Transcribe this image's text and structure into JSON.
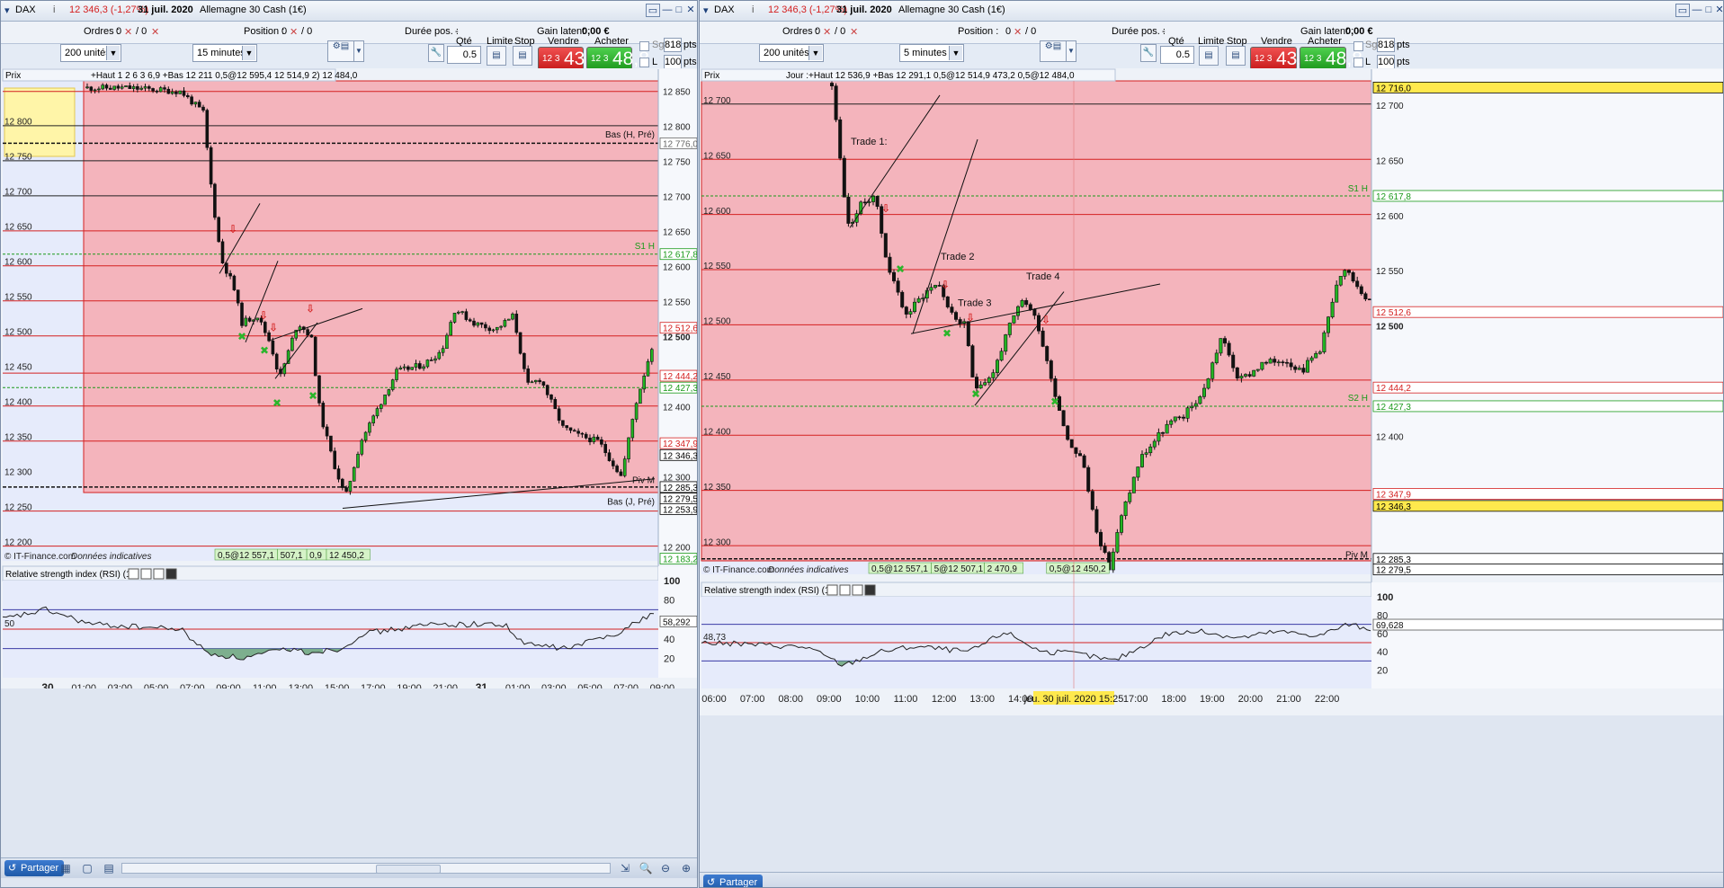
{
  "windows": [
    {
      "id": "w1",
      "title": {
        "symbol": "DAX",
        "quote": "12 346,3 (-1,27%)",
        "date": "31 juil. 2020",
        "instrument": "Allemagne 30 Cash (1€)"
      },
      "info": {
        "orders_label": "Ordres :",
        "orders_value": "0",
        "orders_sep": "/ 0",
        "position_label": "Position :",
        "position_value": "0",
        "position_sep": "/ 0",
        "duration_label": "Durée pos. :",
        "duration_value": "-",
        "gain_label": "Gain latent :",
        "gain_value": "0,00 €"
      },
      "toolbar": {
        "units": "200 unités",
        "interval": "15 minutes",
        "qty_label": "Qté",
        "qty_value": "0.5",
        "limit_label": "Limite",
        "stop_label": "Stop",
        "sell_label": "Vendre",
        "buy_label": "Acheter",
        "sell_small": "12 3",
        "sell_big": "43,8",
        "buy_small": "12 3",
        "buy_big": "48,8",
        "sg_label": "Sg",
        "pts_value_1": "818",
        "pts_label_1": "pts",
        "l_label": "L",
        "pts_value_2": "100",
        "pts_label_2": "pts"
      },
      "chart_header": {
        "label": "Prix",
        "legend": "+Haut 1 2 6 3 6,9 +Bas 12 211 0,5@12 595,4 12 514,9 2) 12 484,0"
      },
      "chart_data": {
        "type": "candlestick",
        "ylim": [
          12180,
          12865
        ],
        "x_ticks": [
          "30",
          "01:00",
          "03:00",
          "05:00",
          "07:00",
          "09:00",
          "11:00",
          "13:00",
          "15:00",
          "17:00",
          "19:00",
          "21:00",
          "31",
          "01:00",
          "03:00",
          "05:00",
          "07:00",
          "09:00"
        ],
        "y_ticks_left": [
          "12 800",
          "12 750",
          "12 700",
          "12 650",
          "12 600",
          "12 550",
          "12 500",
          "12 450",
          "12 400",
          "12 350",
          "12 300",
          "12 250",
          "12 200"
        ],
        "y_ticks_right": [
          "12 850",
          "12 800",
          "12 750",
          "12 700",
          "12 650",
          "12 600",
          "12 550",
          "12 500",
          "12 400",
          "12 300",
          "12 200"
        ],
        "price_tags": [
          {
            "text": "12 776,0",
            "value": 12776,
            "color": "#666666"
          },
          {
            "text": "12 617,8",
            "value": 12617.8,
            "color": "#1a9a1a"
          },
          {
            "text": "12 512,6",
            "value": 12512.6,
            "color": "#d42020"
          },
          {
            "text": "12 444,2",
            "value": 12444.2,
            "color": "#d42020"
          },
          {
            "text": "12 427,3",
            "value": 12427.3,
            "color": "#1a9a1a"
          },
          {
            "text": "12 347,9",
            "value": 12347.9,
            "color": "#d42020"
          },
          {
            "text": "12 346,3",
            "value": 12331,
            "color": "#000000"
          },
          {
            "text": "12 285,3",
            "value": 12285.3,
            "color": "#000000"
          },
          {
            "text": "12 279,5",
            "value": 12269,
            "color": "#000000"
          },
          {
            "text": "12 253,9",
            "value": 12253.9,
            "color": "#000000"
          },
          {
            "text": "12 183,2",
            "value": 12183.2,
            "color": "#1a9a1a"
          }
        ],
        "line_labels": [
          {
            "text": "Bas (H, Pré)",
            "value": 12784
          },
          {
            "text": "S1 H",
            "value": 12625
          },
          {
            "text": "Piv M",
            "value": 12291
          },
          {
            "text": "Bas (J, Pré)",
            "value": 12260
          }
        ],
        "order_labels": [
          "0,5@12 557,1",
          "507,1",
          "0,9",
          "12 450,2"
        ],
        "copyright": "© IT-Finance.com",
        "disclaimer": "Données indicatives"
      },
      "rsi": {
        "title": "Relative strength index (RSI) (14)",
        "value_tag": "58,292",
        "left_label": "50",
        "levels": [
          "100",
          "80",
          "60",
          "40",
          "20"
        ]
      },
      "status": {
        "share": "Partager"
      }
    },
    {
      "id": "w2",
      "title": {
        "symbol": "DAX",
        "quote": "12 346,3 (-1,27%)",
        "date": "31 juil. 2020",
        "instrument": "Allemagne 30 Cash (1€)"
      },
      "info": {
        "orders_label": "Ordres :",
        "orders_value": "0",
        "orders_sep": "/ 0",
        "position_label": "Position :",
        "position_value": "0",
        "position_sep": "/ 0",
        "duration_label": "Durée pos. :",
        "duration_value": "-",
        "gain_label": "Gain latent :",
        "gain_value": "0,00 €"
      },
      "toolbar": {
        "units": "200 unités",
        "interval": "5 minutes",
        "qty_label": "Qté",
        "qty_value": "0.5",
        "limit_label": "Limite",
        "stop_label": "Stop",
        "sell_label": "Vendre",
        "buy_label": "Acheter",
        "sell_small": "12 3",
        "sell_big": "43,8",
        "buy_small": "12 3",
        "buy_big": "48,8",
        "sg_label": "Sg",
        "pts_value_1": "818",
        "pts_label_1": "pts",
        "l_label": "L",
        "pts_value_2": "100",
        "pts_label_2": "pts"
      },
      "chart_header": {
        "label": "Prix",
        "legend": "Jour :+Haut 12 536,9 +Bas 12 291,1 0,5@12 514,9 473,2 0,5@12 484,0"
      },
      "chart_data": {
        "type": "candlestick",
        "ylim": [
          12275,
          12722
        ],
        "x_ticks": [
          "06:00",
          "07:00",
          "08:00",
          "09:00",
          "10:00",
          "11:00",
          "12:00",
          "13:00",
          "14:00",
          "15:00",
          "16:00",
          "17:00",
          "18:00",
          "19:00",
          "20:00",
          "21:00",
          "22:00"
        ],
        "crosshair_label": "jeu. 30 juil. 2020 15:25",
        "y_ticks_left": [
          "12 700",
          "12 650",
          "12 600",
          "12 550",
          "12 500",
          "12 450",
          "12 400",
          "12 350",
          "12 300"
        ],
        "y_ticks_right": [
          "12 700",
          "12 650",
          "12 600",
          "12 550",
          "12 500",
          "12 400"
        ],
        "price_tags": [
          {
            "text": "12 716,0",
            "value": 12716,
            "color": "#000000",
            "fill": "#ffe94d"
          },
          {
            "text": "12 617,8",
            "value": 12617.8,
            "color": "#1a9a1a"
          },
          {
            "text": "12 512,6",
            "value": 12512.6,
            "color": "#d42020"
          },
          {
            "text": "12 444,2",
            "value": 12444.2,
            "color": "#d42020"
          },
          {
            "text": "12 427,3",
            "value": 12427.3,
            "color": "#1a9a1a"
          },
          {
            "text": "12 347,9",
            "value": 12347.9,
            "color": "#d42020"
          },
          {
            "text": "12 346,3",
            "value": 12337,
            "color": "#000000",
            "fill": "#ffe94d"
          },
          {
            "text": "12 285,3",
            "value": 12289,
            "color": "#000000"
          },
          {
            "text": "12 279,5",
            "value": 12279.5,
            "color": "#000000"
          }
        ],
        "line_labels": [
          {
            "text": "S1 H",
            "value": 12622
          },
          {
            "text": "S2 H",
            "value": 12432
          },
          {
            "text": "Piv M",
            "value": 12290
          }
        ],
        "annotations": [
          "Trade 1:",
          "Trade 2",
          "Trade 3",
          "Trade 4"
        ],
        "order_labels": [
          "0,5@12 557,1",
          "5@12 507,1",
          "2 470,9",
          "0,5@12 450,2"
        ],
        "copyright": "© IT-Finance.com",
        "disclaimer": "Données indicatives"
      },
      "rsi": {
        "title": "Relative strength index (RSI) (14)",
        "value_tag": "69,628",
        "left_label": "48,73",
        "levels": [
          "100",
          "80",
          "60",
          "40",
          "20"
        ]
      },
      "status": {
        "share": "Partager"
      }
    }
  ],
  "colors": {
    "chart_bg": "#e6ebfb",
    "day_zone": "#f4b4bc",
    "resistance": "#d42020",
    "pivot_green": "#1a9a1a",
    "candle_up": "#22b422",
    "candle_down": "#111111",
    "rsi_fill": "#6aa57a"
  }
}
